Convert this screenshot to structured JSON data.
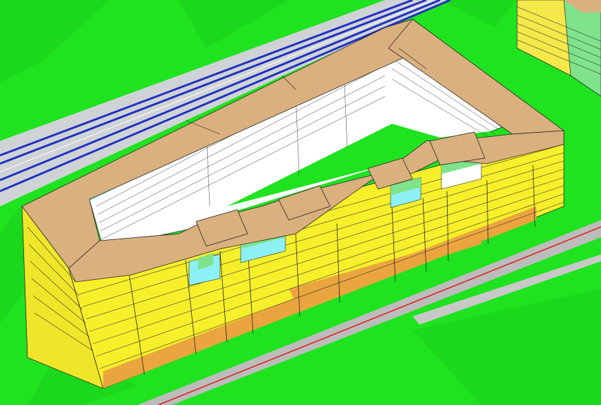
{
  "scene": {
    "kind": "3d-building-massing-view",
    "colors": {
      "terrain": "#1fe31f",
      "terrain_shade": "#19c919",
      "roof": "#d9b07e",
      "facade_lit": "#f6ef2a",
      "facade_orange": "#eba53f",
      "courtyard_wall": "#ffffff",
      "balcony_cyan": "#8cf0f4",
      "balcony_green": "#7ee38a",
      "road": "#c0c0c0",
      "road_edge_red": "#e01818",
      "rail": "#2030c0",
      "neighbor_building": "#f4e84a"
    }
  }
}
